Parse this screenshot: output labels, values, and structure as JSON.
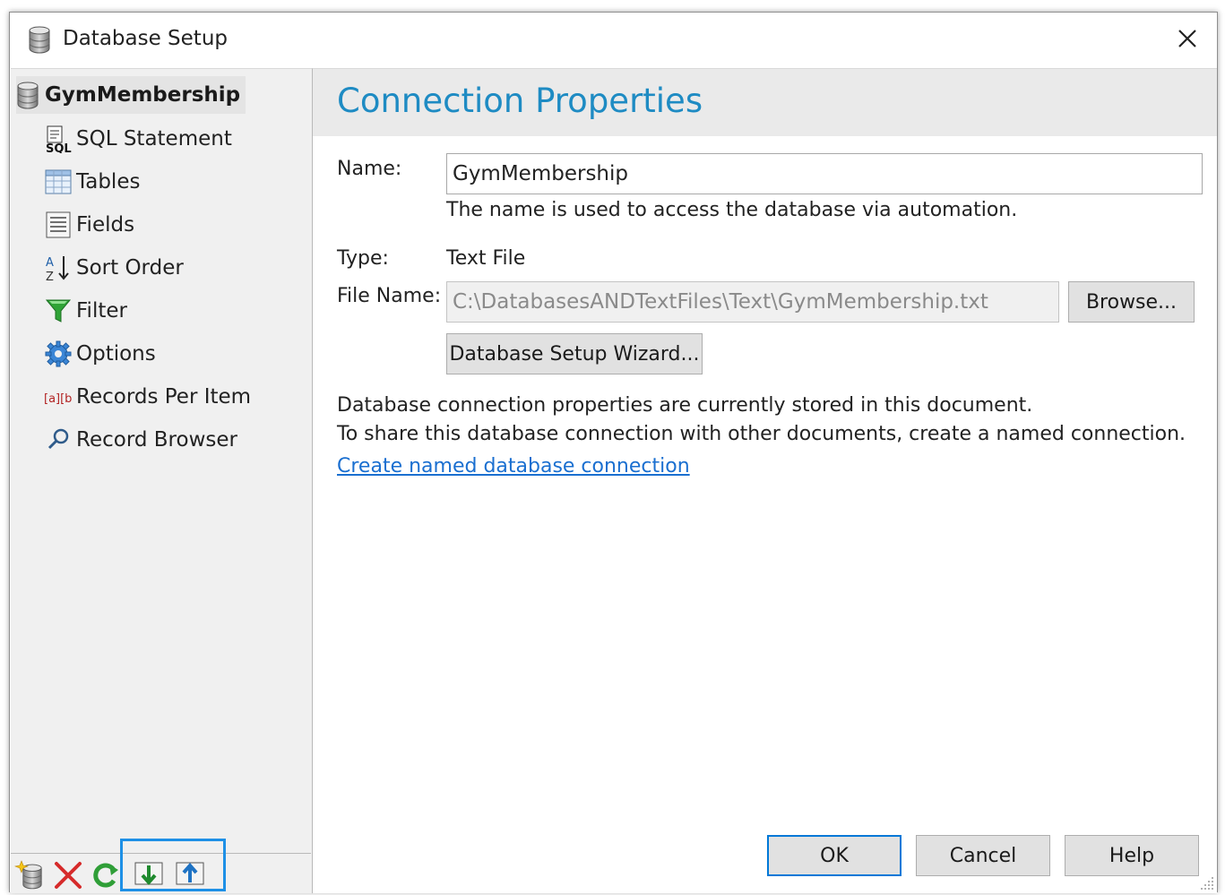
{
  "window": {
    "title": "Database Setup",
    "icon": "database-icon",
    "close_icon": "close-icon"
  },
  "sidebar": {
    "root": {
      "label": "GymMembership",
      "icon": "database-icon"
    },
    "items": [
      {
        "label": "SQL Statement",
        "icon": "sql-icon"
      },
      {
        "label": "Tables",
        "icon": "table-icon"
      },
      {
        "label": "Fields",
        "icon": "fields-icon"
      },
      {
        "label": "Sort Order",
        "icon": "sort-az-icon"
      },
      {
        "label": "Filter",
        "icon": "filter-funnel-icon"
      },
      {
        "label": "Options",
        "icon": "gear-icon"
      },
      {
        "label": "Records Per Item",
        "icon": "records-per-item-icon"
      },
      {
        "label": "Record Browser",
        "icon": "magnifier-icon"
      }
    ],
    "toolbar": [
      {
        "name": "new-database-button",
        "icon": "new-database-icon"
      },
      {
        "name": "delete-button",
        "icon": "delete-x-icon"
      },
      {
        "name": "refresh-button",
        "icon": "refresh-icon"
      },
      {
        "name": "import-button",
        "icon": "import-arrow-down-icon"
      },
      {
        "name": "export-button",
        "icon": "export-arrow-up-icon"
      }
    ]
  },
  "main": {
    "heading": "Connection Properties",
    "name_label": "Name:",
    "name_value": "GymMembership",
    "name_hint": "The name is used to access the database via automation.",
    "type_label": "Type:",
    "type_value": "Text File",
    "file_label": "File Name:",
    "file_value": "C:\\DatabasesANDTextFiles\\Text\\GymMembership.txt",
    "browse_label": "Browse...",
    "wizard_label": "Database Setup Wizard...",
    "info_line1": "Database connection properties are currently stored in this document.",
    "info_line2": "To share this database connection with other documents, create a named connection.",
    "link_label": "Create named database connection"
  },
  "footer": {
    "ok_label": "OK",
    "cancel_label": "Cancel",
    "help_label": "Help"
  },
  "colors": {
    "accent": "#1e8bc3",
    "link": "#1a6fd0",
    "highlight_border": "#1e90e6",
    "default_button_border": "#0078d7"
  }
}
